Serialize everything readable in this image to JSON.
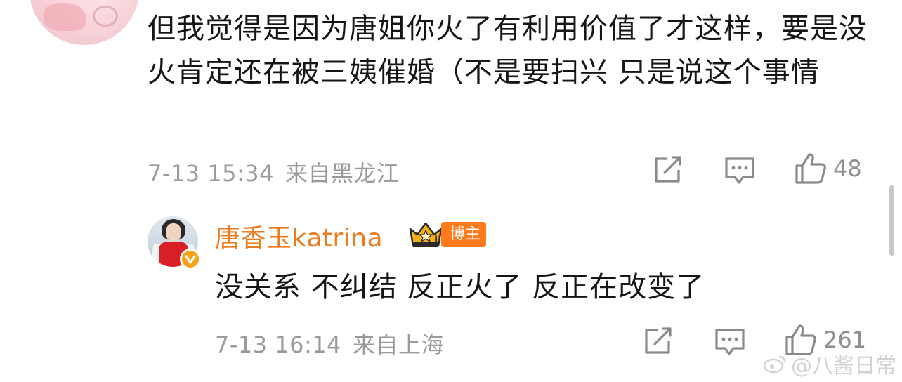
{
  "comment": {
    "text": "但我觉得是因为唐姐你火了有利用价值了才这样，要是没火肯定还在被三姨催婚（不是要扫兴 只是说这个事情",
    "time": "7-13 15:34",
    "location": "来自黑龙江",
    "likes": "48",
    "icons": {
      "share": "share-icon",
      "reply": "comment-icon",
      "like": "thumbs-up-icon"
    }
  },
  "reply": {
    "username": "唐香玉katrina",
    "badge": "博主",
    "crown_label": "II",
    "text": "没关系 不纠结 反正火了 反正在改变了",
    "time": "7-13 16:14",
    "location": "来自上海",
    "likes": "261"
  },
  "watermark": {
    "text": "@八酱日常"
  },
  "colors": {
    "username": "#ee7a1e",
    "badge": "#ff7a1a",
    "meta": "#9a9a9a",
    "verified": "#f7a21b"
  }
}
